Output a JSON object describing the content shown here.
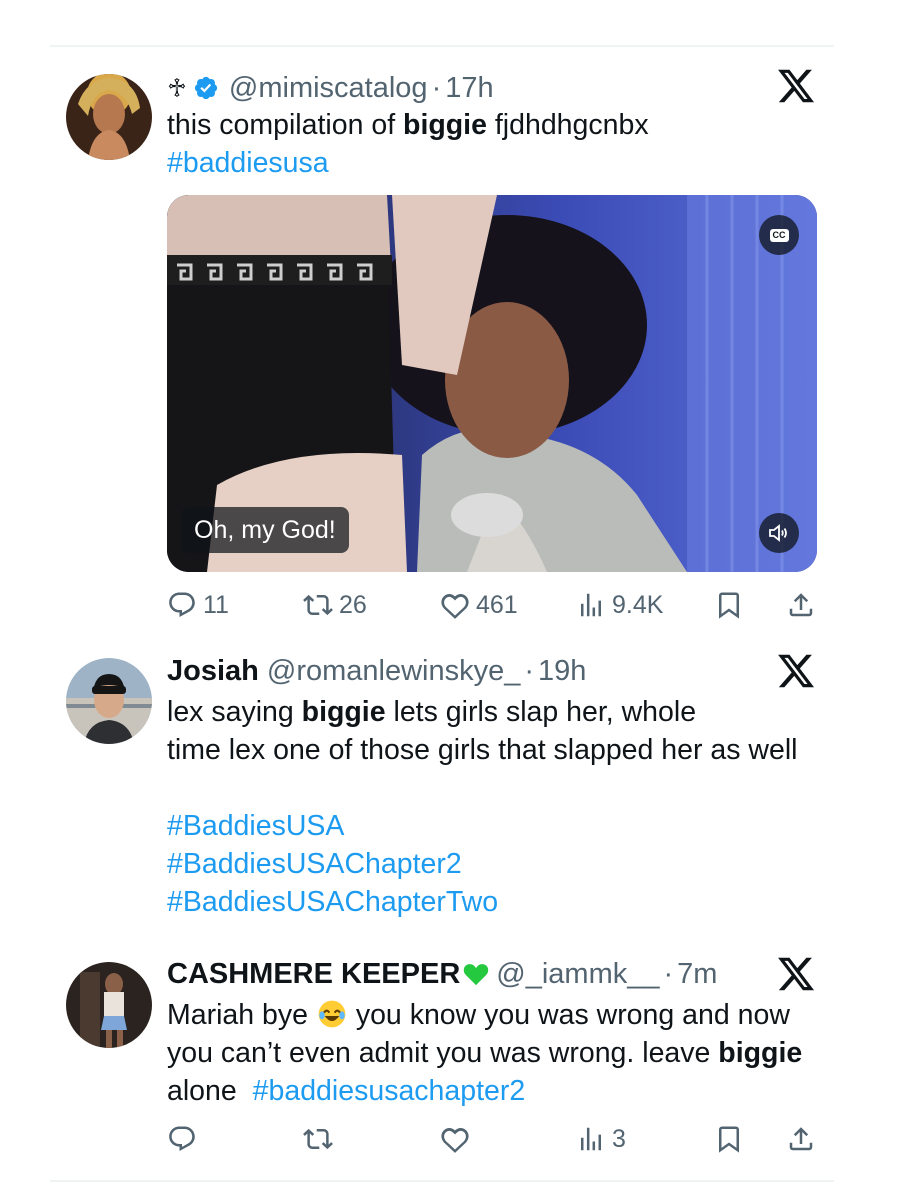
{
  "tweets": [
    {
      "name": "",
      "cross_symbol": "♱",
      "handle": "@mimiscatalog",
      "separator": "·",
      "time": "17h",
      "text_line1_a": "this compilation of ",
      "text_line1_b": "biggie",
      "text_line1_c": " fjdhdhgcnbx",
      "hashtag": "#baddiesusa",
      "media": {
        "caption": "Oh, my God!",
        "cc_label": "CC"
      },
      "metrics": {
        "replies": "11",
        "reposts": "26",
        "likes": "461",
        "views": "9.4K"
      }
    },
    {
      "name": "Josiah",
      "handle": "@romanlewinskye_",
      "separator": "·",
      "time": "19h",
      "text_line1_a": "lex saying ",
      "text_line1_b": "biggie",
      "text_line1_c": " lets girls slap her, whole",
      "text_line2": "time lex one of those girls that slapped her as well",
      "hashtags": [
        "#BaddiesUSA",
        "#BaddiesUSAChapter2",
        "#BaddiesUSAChapterTwo"
      ]
    },
    {
      "name": "CASHMERE KEEPER",
      "handle": "@_iammk__",
      "separator": "·",
      "time": "7m",
      "text_line1_a": "Mariah bye ",
      "text_line1_b": " you know you was wrong and now",
      "text_line2_a": "you can’t even admit you was wrong. leave ",
      "text_line2_b": "biggie",
      "text_line3_a": "alone ",
      "hashtag": "#baddiesusachapter2",
      "metrics": {
        "views": "3"
      }
    }
  ],
  "icons": {
    "x_logo": "x-logo-icon",
    "verified": "verified-badge-icon",
    "reply": "reply-icon",
    "repost": "repost-icon",
    "like": "like-icon",
    "views": "views-icon",
    "bookmark": "bookmark-icon",
    "share": "share-icon"
  },
  "colors": {
    "link": "#1d9bf0",
    "secondary": "#536471",
    "text": "#0f1419",
    "verified": "#1d9bf0",
    "heart_emoji": "#25c93f"
  }
}
